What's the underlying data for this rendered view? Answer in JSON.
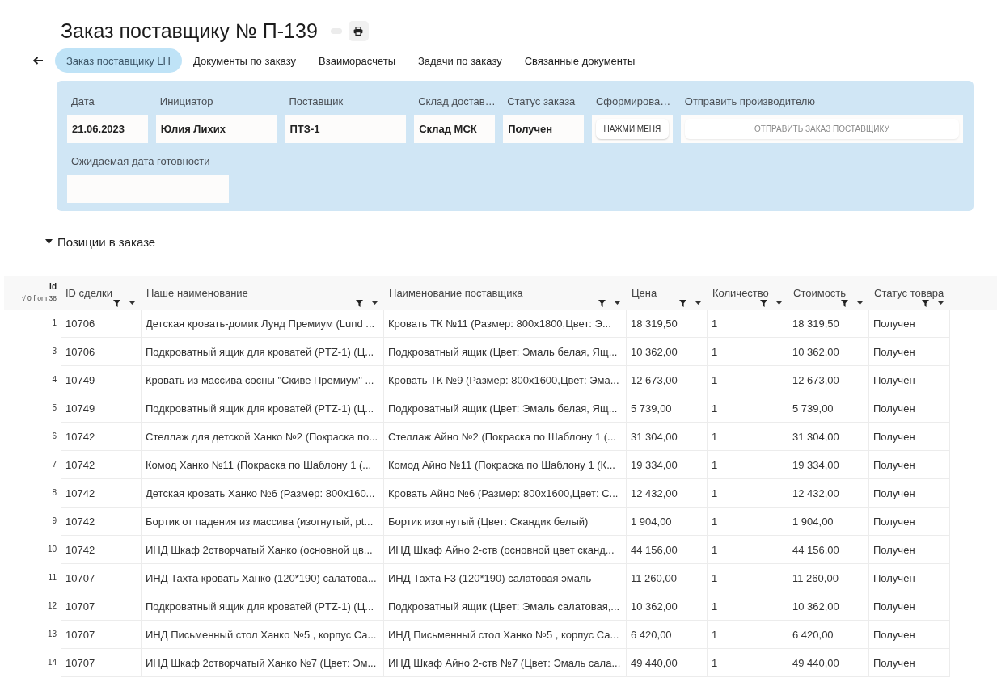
{
  "header": {
    "title": "Заказ поставщику № П-139"
  },
  "tabs": [
    {
      "label": "Заказ поставщику LH",
      "selected": true
    },
    {
      "label": "Документы по заказу",
      "selected": false
    },
    {
      "label": "Взаиморасчеты",
      "selected": false
    },
    {
      "label": "Задачи по заказу",
      "selected": false
    },
    {
      "label": "Связанные документы",
      "selected": false
    }
  ],
  "form": {
    "rows": [
      {
        "fields": [
          {
            "kind": "text",
            "label": "Дата",
            "value": "21.06.2023"
          },
          {
            "kind": "text",
            "label": "Инициатор",
            "value": "Юлия Лихих"
          },
          {
            "kind": "text",
            "label": "Поставщик",
            "value": "ПТЗ-1"
          },
          {
            "kind": "text",
            "label": "Склад достав…",
            "value": "Склад МСК"
          },
          {
            "kind": "text",
            "label": "Статус заказа",
            "value": "Получен"
          },
          {
            "kind": "button",
            "label": "Сформирова…",
            "button": "НАЖМИ МЕНЯ",
            "disabled": false
          },
          {
            "kind": "button",
            "label": "Отправить производителю",
            "button": "ОТПРАВИТЬ ЗАКАЗ ПОСТАВЩИКУ",
            "disabled": true
          }
        ]
      },
      {
        "fields": [
          {
            "kind": "text",
            "label": "Ожидаемая дата готовности"
          }
        ]
      }
    ]
  },
  "positions": {
    "title": "Позиции в заказе",
    "expanded": true,
    "id_column": {
      "label": "id",
      "summary": "√ 0 from 38"
    },
    "columns": [
      "ID сделки",
      "Наше наименование",
      "Наименование поставщика",
      "Цена",
      "Количество",
      "Стоимость",
      "Статус товара"
    ],
    "rows": [
      {
        "number": "1",
        "cells": [
          "10706",
          "Детская кровать-домик Лунд Премиум (Lund ...",
          "Кровать ТК №11 (Размер: 800х1800,Цвет: Э...",
          "18 319,50",
          "1",
          "18 319,50",
          "Получен"
        ]
      },
      {
        "number": "3",
        "cells": [
          "10706",
          "Подкроватный ящик для кроватей (PTZ-1) (Ц...",
          "Подкроватный ящик (Цвет: Эмаль белая, Ящ...",
          "10 362,00",
          "1",
          "10 362,00",
          "Получен"
        ]
      },
      {
        "number": "4",
        "cells": [
          "10749",
          "Кровать из массива сосны \"Скиве Премиум\" ...",
          "Кровать ТК №9 (Размер: 800х1600,Цвет: Эма...",
          "12 673,00",
          "1",
          "12 673,00",
          "Получен"
        ]
      },
      {
        "number": "5",
        "cells": [
          "10749",
          "Подкроватный ящик для кроватей (PTZ-1) (Ц...",
          "Подкроватный ящик (Цвет: Эмаль белая, Ящ...",
          "5 739,00",
          "1",
          "5 739,00",
          "Получен"
        ]
      },
      {
        "number": "6",
        "cells": [
          "10742",
          "Стеллаж для детской Ханко №2 (Покраска по...",
          "Стеллаж Айно №2 (Покраска по Шаблону 1 (...",
          "31 304,00",
          "1",
          "31 304,00",
          "Получен"
        ]
      },
      {
        "number": "7",
        "cells": [
          "10742",
          "Комод Ханко №11 (Покраска по Шаблону 1 (...",
          "Комод Айно №11 (Покраска по Шаблону 1 (К...",
          "19 334,00",
          "1",
          "19 334,00",
          "Получен"
        ]
      },
      {
        "number": "8",
        "cells": [
          "10742",
          "Детская кровать Ханко №6 (Размер: 800х160...",
          "Кровать Айно №6 (Размер: 800х1600,Цвет: С...",
          "12 432,00",
          "1",
          "12 432,00",
          "Получен"
        ]
      },
      {
        "number": "9",
        "cells": [
          "10742",
          "Бортик от падения из массива (изогнутый, pt...",
          "Бортик изогнутый (Цвет: Скандик белый)",
          "1 904,00",
          "1",
          "1 904,00",
          "Получен"
        ]
      },
      {
        "number": "10",
        "cells": [
          "10742",
          "ИНД Шкаф 2створчатый Ханко (основной цв...",
          "ИНД Шкаф Айно 2-ств (основной цвет сканд...",
          "44 156,00",
          "1",
          "44 156,00",
          "Получен"
        ]
      },
      {
        "number": "11",
        "cells": [
          "10707",
          "ИНД Тахта кровать Ханко (120*190) салатова...",
          "ИНД Тахта F3 (120*190) салатовая эмаль",
          "11 260,00",
          "1",
          "11 260,00",
          "Получен"
        ]
      },
      {
        "number": "12",
        "cells": [
          "10707",
          "Подкроватный ящик для кроватей (PTZ-1) (Ц...",
          "Подкроватный ящик (Цвет: Эмаль салатовая,...",
          "10 362,00",
          "1",
          "10 362,00",
          "Получен"
        ]
      },
      {
        "number": "13",
        "cells": [
          "10707",
          "ИНД Письменный стол Ханко №5 , корпус Са...",
          "ИНД Письменный стол Ханко №5 , корпус Са...",
          "6 420,00",
          "1",
          "6 420,00",
          "Получен"
        ]
      },
      {
        "number": "14",
        "cells": [
          "10707",
          "ИНД Шкаф 2створчатый Ханко №7 (Цвет: Эм...",
          "ИНД Шкаф Айно 2-ств №7 (Цвет: Эмаль сала...",
          "49 440,00",
          "1",
          "49 440,00",
          "Получен"
        ]
      }
    ]
  }
}
